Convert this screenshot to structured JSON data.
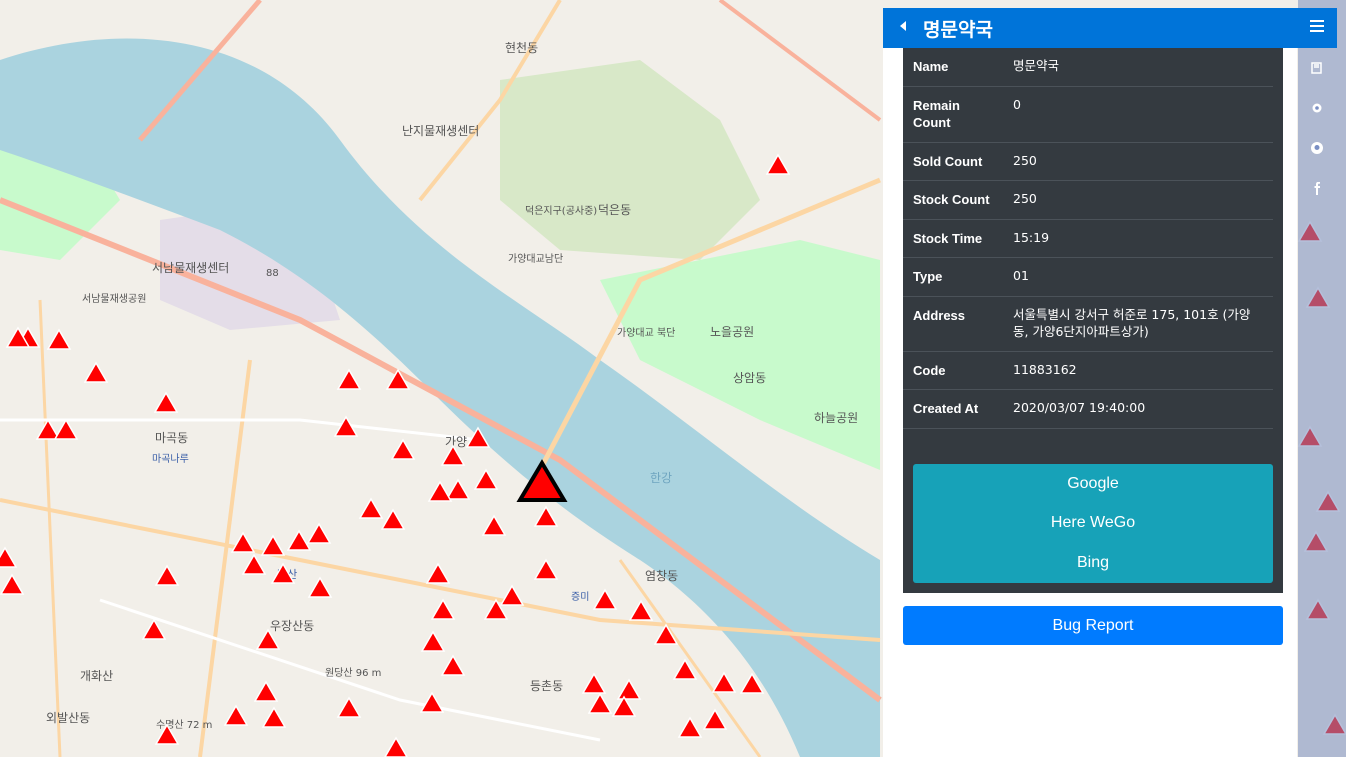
{
  "panel": {
    "title": "명문약국",
    "info": [
      {
        "key": "Name",
        "value": "명문약국"
      },
      {
        "key": "Remain Count",
        "value": "0"
      },
      {
        "key": "Sold Count",
        "value": "250"
      },
      {
        "key": "Stock Count",
        "value": "250"
      },
      {
        "key": "Stock Time",
        "value": "15:19"
      },
      {
        "key": "Type",
        "value": "01"
      },
      {
        "key": "Address",
        "value": "서울특별시 강서구 허준로 175, 101호 (가양동, 가양6단지아파트상가)"
      },
      {
        "key": "Code",
        "value": "11883162"
      },
      {
        "key": "Created At",
        "value": "2020/03/07 19:40:00"
      }
    ],
    "links": [
      "Google",
      "Here WeGo",
      "Bing"
    ],
    "bug_report": "Bug Report"
  },
  "sidebar_tabs": [
    "book-icon",
    "gear-icon",
    "github-icon",
    "facebook-icon"
  ],
  "map": {
    "labels": [
      "현천동",
      "난지물재생센터",
      "덕은동",
      "덕은지구(공사중)",
      "노을공원",
      "상암동",
      "하늘공원",
      "서남물재생센터",
      "서남물재생공원",
      "마곡동",
      "마곡나루",
      "가양",
      "염창동",
      "증미",
      "등촌동",
      "원당산 96 m",
      "발산",
      "우장산동",
      "수명산 72 m",
      "외발산동",
      "개화산",
      "한강",
      "88",
      "가양대교 북단",
      "가양대교남단"
    ],
    "colors": {
      "water": "#aad3df",
      "park": "#c8facc",
      "land": "#f2efe9",
      "marker": "#ff0000",
      "header": "#0074d9",
      "card": "#343a40",
      "links": "#17a2b8",
      "bug": "#007bff"
    }
  }
}
